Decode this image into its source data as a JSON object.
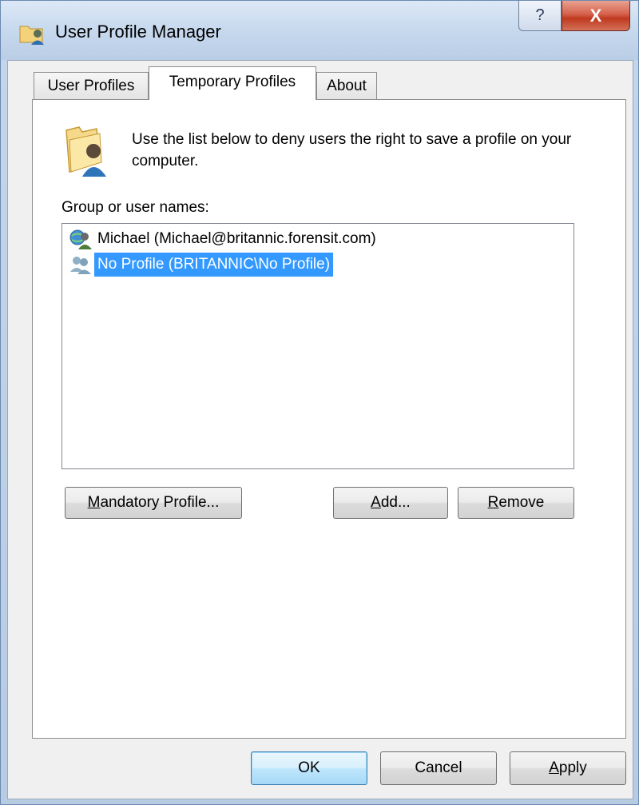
{
  "window": {
    "title": "User Profile Manager",
    "help_glyph": "?",
    "close_glyph": "X"
  },
  "tabs": [
    {
      "label": "User Profiles",
      "active": false
    },
    {
      "label": "Temporary Profiles",
      "active": true
    },
    {
      "label": "About",
      "active": false
    }
  ],
  "panel": {
    "info_text": "Use the list below to deny users the right to save a profile on your computer.",
    "group_label": "Group or user names:",
    "list_items": [
      {
        "label": "Michael (Michael@britannic.forensit.com)",
        "icon": "user-globe-icon",
        "selected": false
      },
      {
        "label": "No Profile (BRITANNIC\\No Profile)",
        "icon": "user-group-icon",
        "selected": true
      }
    ],
    "buttons": {
      "mandatory": {
        "mnemonic": "M",
        "rest": "andatory Profile..."
      },
      "add": {
        "mnemonic": "A",
        "rest": "dd..."
      },
      "remove": {
        "mnemonic": "R",
        "rest": "emove"
      }
    }
  },
  "footer": {
    "ok": "OK",
    "cancel": "Cancel",
    "apply": {
      "mnemonic": "A",
      "rest": "pply"
    }
  },
  "colors": {
    "selection": "#3399ff",
    "default_button_border": "#3c7fb1",
    "close_button": "#c0391f"
  }
}
